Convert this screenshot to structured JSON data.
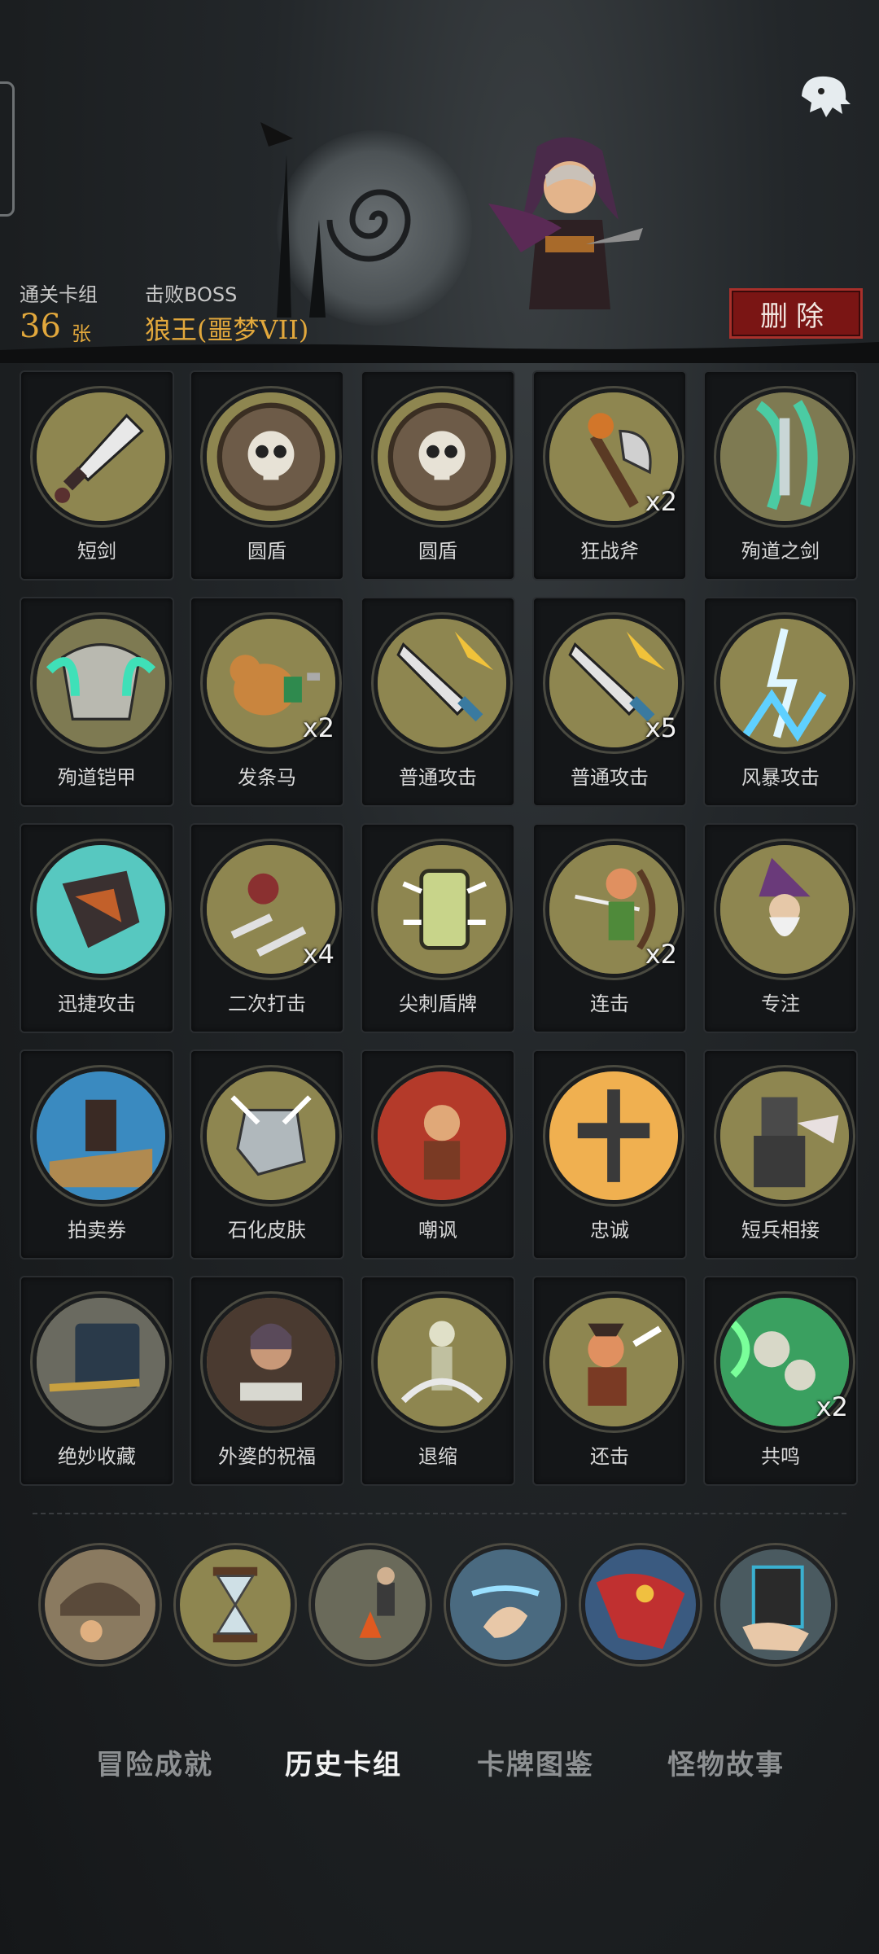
{
  "header": {
    "deck_label": "通关卡组",
    "deck_count": "36",
    "deck_unit": "张",
    "boss_label": "击败BOSS",
    "boss_name": "狼王(噩梦VII)",
    "delete_label": "删除"
  },
  "cards": [
    {
      "name": "短剑",
      "mult": "",
      "icon": "dagger-icon"
    },
    {
      "name": "圆盾",
      "mult": "",
      "icon": "skull-shield-icon"
    },
    {
      "name": "圆盾",
      "mult": "",
      "icon": "skull-shield-icon"
    },
    {
      "name": "狂战斧",
      "mult": "x2",
      "icon": "axe-icon"
    },
    {
      "name": "殉道之剑",
      "mult": "",
      "icon": "ghost-sword-icon"
    },
    {
      "name": "殉道铠甲",
      "mult": "",
      "icon": "ghost-armor-icon"
    },
    {
      "name": "发条马",
      "mult": "x2",
      "icon": "wind-up-horse-icon"
    },
    {
      "name": "普通攻击",
      "mult": "",
      "icon": "sword-strike-icon"
    },
    {
      "name": "普通攻击",
      "mult": "x5",
      "icon": "sword-strike-icon"
    },
    {
      "name": "风暴攻击",
      "mult": "",
      "icon": "lightning-icon"
    },
    {
      "name": "迅捷攻击",
      "mult": "",
      "icon": "claw-icon"
    },
    {
      "name": "二次打击",
      "mult": "x4",
      "icon": "double-strike-icon"
    },
    {
      "name": "尖刺盾牌",
      "mult": "",
      "icon": "spiked-shield-icon"
    },
    {
      "name": "连击",
      "mult": "x2",
      "icon": "archer-icon"
    },
    {
      "name": "专注",
      "mult": "",
      "icon": "wizard-icon"
    },
    {
      "name": "拍卖券",
      "mult": "",
      "icon": "auction-hammer-icon"
    },
    {
      "name": "石化皮肤",
      "mult": "",
      "icon": "stone-fist-icon"
    },
    {
      "name": "嘲讽",
      "mult": "",
      "icon": "taunt-icon"
    },
    {
      "name": "忠诚",
      "mult": "",
      "icon": "cross-icon"
    },
    {
      "name": "短兵相接",
      "mult": "",
      "icon": "knight-icon"
    },
    {
      "name": "绝妙收藏",
      "mult": "",
      "icon": "collection-icon"
    },
    {
      "name": "外婆的祝福",
      "mult": "",
      "icon": "grandma-icon"
    },
    {
      "name": "退缩",
      "mult": "",
      "icon": "retreat-icon"
    },
    {
      "name": "还击",
      "mult": "",
      "icon": "counter-icon"
    },
    {
      "name": "共鸣",
      "mult": "x2",
      "icon": "resonance-icon"
    }
  ],
  "relics": [
    {
      "icon": "helmet-relic-icon"
    },
    {
      "icon": "hourglass-relic-icon"
    },
    {
      "icon": "campfire-relic-icon"
    },
    {
      "icon": "magic-hand-relic-icon"
    },
    {
      "icon": "cape-relic-icon"
    },
    {
      "icon": "card-hand-relic-icon"
    }
  ],
  "tabs": [
    {
      "label": "冒险成就",
      "active": false
    },
    {
      "label": "历史卡组",
      "active": true
    },
    {
      "label": "卡牌图鉴",
      "active": false
    },
    {
      "label": "怪物故事",
      "active": false
    }
  ],
  "colors": {
    "accent_gold": "#e2a83c",
    "delete_red": "#7a1514",
    "disc_olive": "#8e8650"
  }
}
